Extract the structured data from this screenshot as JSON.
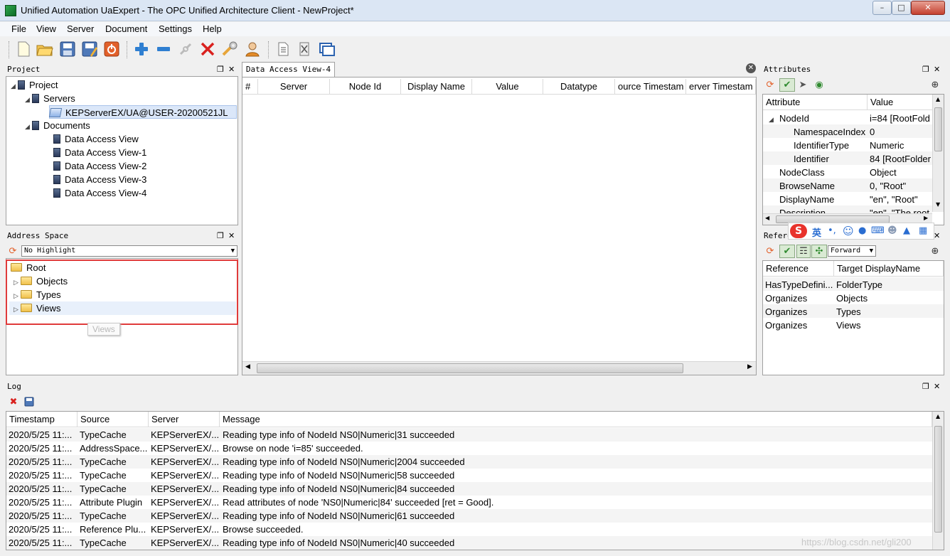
{
  "window": {
    "title": "Unified Automation UaExpert - The OPC Unified Architecture Client - NewProject*"
  },
  "menu": [
    "File",
    "View",
    "Server",
    "Document",
    "Settings",
    "Help"
  ],
  "toolbar": {
    "icons": [
      "new-project-icon",
      "open-project-icon",
      "save-project-icon",
      "save-as-icon",
      "shutdown-icon",
      "add-server-icon",
      "remove-server-icon",
      "connect-icon",
      "disconnect-icon",
      "settings-wrench-icon",
      "user-icon",
      "add-document-icon",
      "remove-document-icon",
      "window-icon"
    ]
  },
  "project": {
    "title": "Project",
    "root": "Project",
    "servers_label": "Servers",
    "server": "KEPServerEX/UA@USER-20200521JL",
    "documents_label": "Documents",
    "documents": [
      "Data Access View",
      "Data Access View-1",
      "Data Access View-2",
      "Data Access View-3",
      "Data Access View-4"
    ]
  },
  "address_space": {
    "title": "Address Space",
    "highlight": "No Highlight",
    "root": "Root",
    "children": [
      "Objects",
      "Types",
      "Views"
    ],
    "tooltip": "Views"
  },
  "data_access": {
    "tab": "Data Access View-4",
    "columns": [
      "#",
      "Server",
      "Node Id",
      "Display Name",
      "Value",
      "Datatype",
      "ource Timestam",
      "erver Timestam"
    ]
  },
  "attributes": {
    "title": "Attributes",
    "columns": [
      "Attribute",
      "Value"
    ],
    "rows": [
      {
        "attr": "NodeId",
        "value": "i=84 [RootFold"
      },
      {
        "attr": "NamespaceIndex",
        "value": "0"
      },
      {
        "attr": "IdentifierType",
        "value": "Numeric"
      },
      {
        "attr": "Identifier",
        "value": "84 [RootFolder"
      },
      {
        "attr": "NodeClass",
        "value": "Object"
      },
      {
        "attr": "BrowseName",
        "value": "0, \"Root\""
      },
      {
        "attr": "DisplayName",
        "value": "\"en\", \"Root\""
      },
      {
        "attr": "Description",
        "value": "\"en\", \"The root"
      }
    ]
  },
  "references": {
    "title": "Refere",
    "direction": "Forward",
    "columns": [
      "Reference",
      "Target DisplayName"
    ],
    "rows": [
      {
        "ref": "HasTypeDefini...",
        "target": "FolderType"
      },
      {
        "ref": "Organizes",
        "target": "Objects"
      },
      {
        "ref": "Organizes",
        "target": "Types"
      },
      {
        "ref": "Organizes",
        "target": "Views"
      }
    ]
  },
  "ime": {
    "lang": "英"
  },
  "log": {
    "title": "Log",
    "columns": [
      "Timestamp",
      "Source",
      "Server",
      "Message"
    ],
    "rows": [
      {
        "ts": "2020/5/25 11:...",
        "src": "TypeCache",
        "srv": "KEPServerEX/...",
        "msg": "Reading type info of NodeId NS0|Numeric|31 succeeded"
      },
      {
        "ts": "2020/5/25 11:...",
        "src": "AddressSpace...",
        "srv": "KEPServerEX/...",
        "msg": "Browse on node 'i=85' succeeded."
      },
      {
        "ts": "2020/5/25 11:...",
        "src": "TypeCache",
        "srv": "KEPServerEX/...",
        "msg": "Reading type info of NodeId NS0|Numeric|2004 succeeded"
      },
      {
        "ts": "2020/5/25 11:...",
        "src": "TypeCache",
        "srv": "KEPServerEX/...",
        "msg": "Reading type info of NodeId NS0|Numeric|58 succeeded"
      },
      {
        "ts": "2020/5/25 11:...",
        "src": "TypeCache",
        "srv": "KEPServerEX/...",
        "msg": "Reading type info of NodeId NS0|Numeric|84 succeeded"
      },
      {
        "ts": "2020/5/25 11:...",
        "src": "Attribute Plugin",
        "srv": "KEPServerEX/...",
        "msg": "Read attributes of node 'NS0|Numeric|84' succeeded [ret = Good]."
      },
      {
        "ts": "2020/5/25 11:...",
        "src": "TypeCache",
        "srv": "KEPServerEX/...",
        "msg": "Reading type info of NodeId NS0|Numeric|61 succeeded"
      },
      {
        "ts": "2020/5/25 11:...",
        "src": "Reference Plu...",
        "srv": "KEPServerEX/...",
        "msg": "Browse succeeded."
      },
      {
        "ts": "2020/5/25 11:...",
        "src": "TypeCache",
        "srv": "KEPServerEX/...",
        "msg": "Reading type info of NodeId NS0|Numeric|40 succeeded"
      }
    ]
  },
  "watermark": "https://blog.csdn.net/gli200"
}
